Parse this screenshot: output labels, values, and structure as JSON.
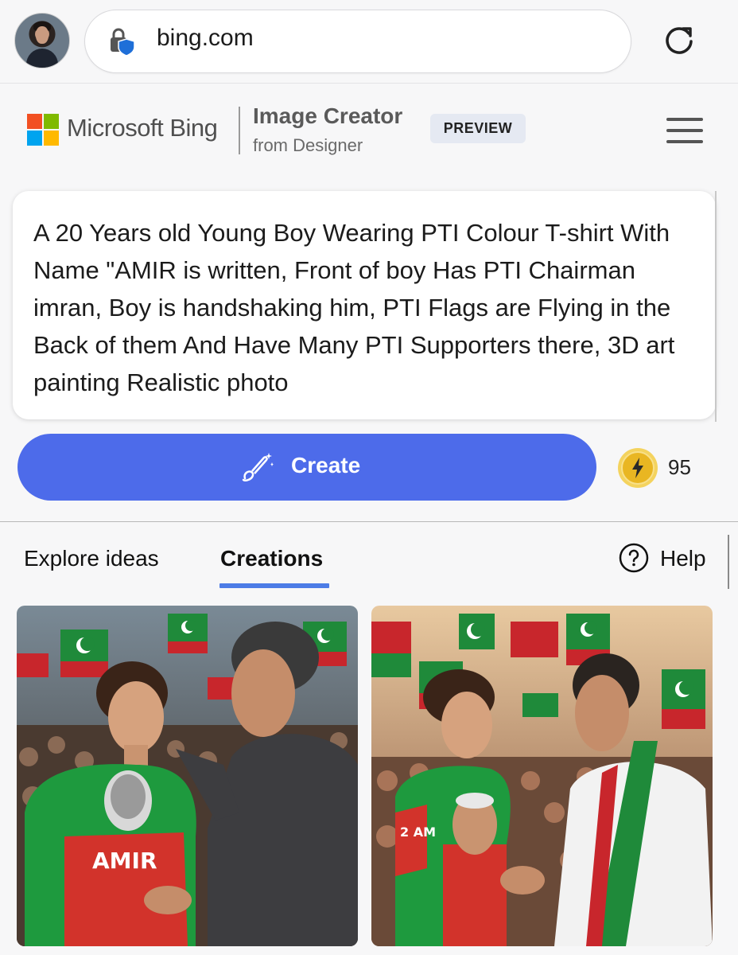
{
  "browser": {
    "url": "bing.com",
    "icons": [
      "profile-avatar",
      "lock-shield-icon",
      "reload-icon"
    ]
  },
  "header": {
    "brand": "Microsoft Bing",
    "product_title": "Image Creator",
    "product_subtitle": "from Designer",
    "badge": "PREVIEW",
    "logo_colors": [
      "#f25022",
      "#7fba00",
      "#00a4ef",
      "#ffb900"
    ]
  },
  "prompt": {
    "text": "A 20 Years old Young Boy Wearing PTI Colour T-shirt With Name \"AMIR is written, Front of boy Has PTI Chairman imran, Boy is handshaking him, PTI Flags are Flying in the Back of them And Have Many PTI Supporters there, 3D art painting Realistic photo"
  },
  "create": {
    "label": "Create",
    "boosts": "95",
    "accent": "#4d6bea"
  },
  "tabs": {
    "explore": "Explore ideas",
    "creations": "Creations",
    "help": "Help",
    "active": "Creations"
  },
  "results": {
    "tile1_shirt_text": "AMIR",
    "tile2_shirt_text": "2 AM"
  }
}
